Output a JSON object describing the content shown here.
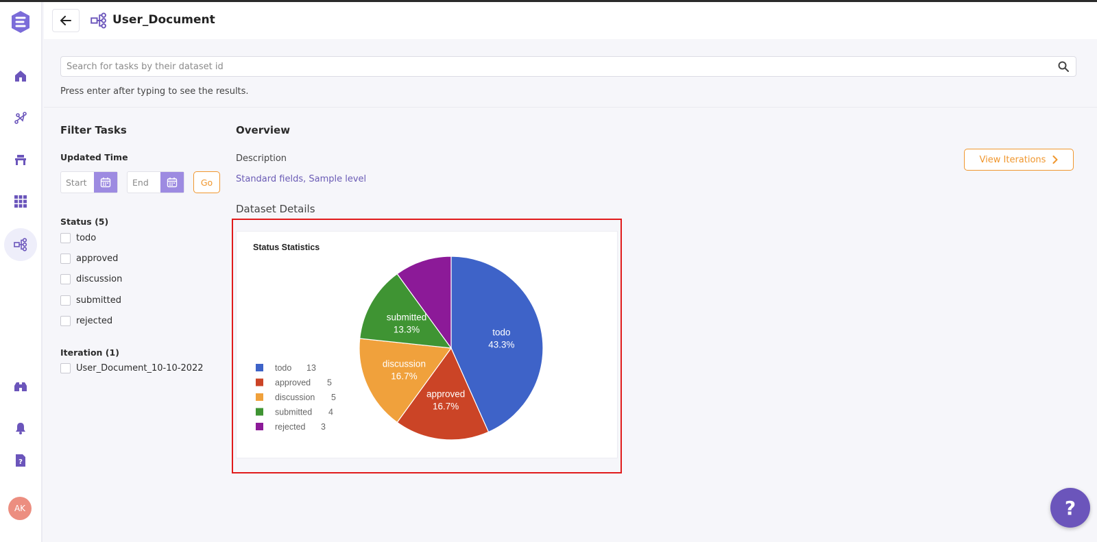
{
  "header": {
    "title": "User_Document"
  },
  "search": {
    "placeholder": "Search for tasks by their dataset id",
    "value": "",
    "hint": "Press enter after typing to see the results."
  },
  "filters": {
    "title": "Filter Tasks",
    "updated_time_label": "Updated Time",
    "start_placeholder": "Start",
    "end_placeholder": "End",
    "go_label": "Go",
    "status_label": "Status (5)",
    "statuses": [
      "todo",
      "approved",
      "discussion",
      "submitted",
      "rejected"
    ],
    "iteration_label": "Iteration (1)",
    "iterations": [
      "User_Document_10-10-2022"
    ]
  },
  "overview": {
    "title": "Overview",
    "description_label": "Description",
    "description_value": "Standard fields, Sample level",
    "view_iterations_label": "View Iterations",
    "dataset_details_label": "Dataset Details"
  },
  "avatar": {
    "initials": "AK"
  },
  "help": {
    "label": "?"
  },
  "chart_data": {
    "type": "pie",
    "title": "Status Statistics",
    "legend_position": "bottom-left",
    "categories": [
      "todo",
      "approved",
      "discussion",
      "submitted",
      "rejected"
    ],
    "values": [
      13,
      5,
      5,
      4,
      3
    ],
    "slice_labels": [
      "43.3%",
      "16.7%",
      "16.7%",
      "13.3%",
      ""
    ],
    "colors": [
      "#3e63c8",
      "#cb4426",
      "#f0a13c",
      "#3f9433",
      "#8c1a98"
    ]
  },
  "colors": {
    "accent": "#6b55bb",
    "orange": "#f0962d",
    "highlight": "#e01a1a"
  }
}
